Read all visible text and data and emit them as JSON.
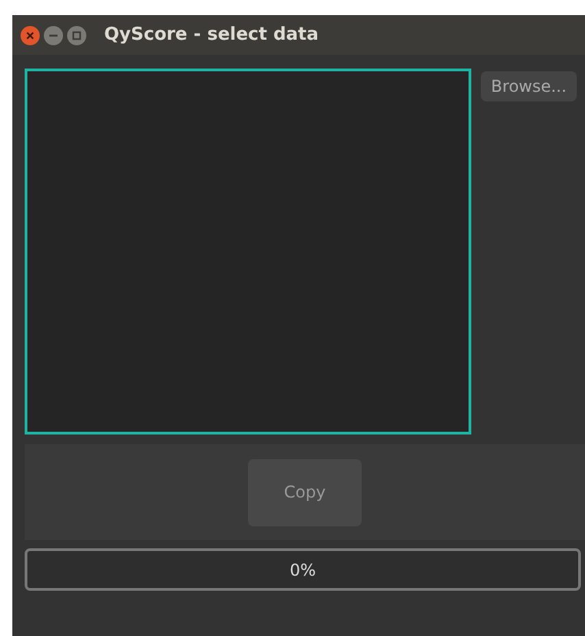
{
  "window": {
    "title": "QyScore - select data"
  },
  "browse_button": {
    "label": "Browse..."
  },
  "copy_button": {
    "label": "Copy",
    "disabled": true
  },
  "progress": {
    "reading": "0%"
  }
}
